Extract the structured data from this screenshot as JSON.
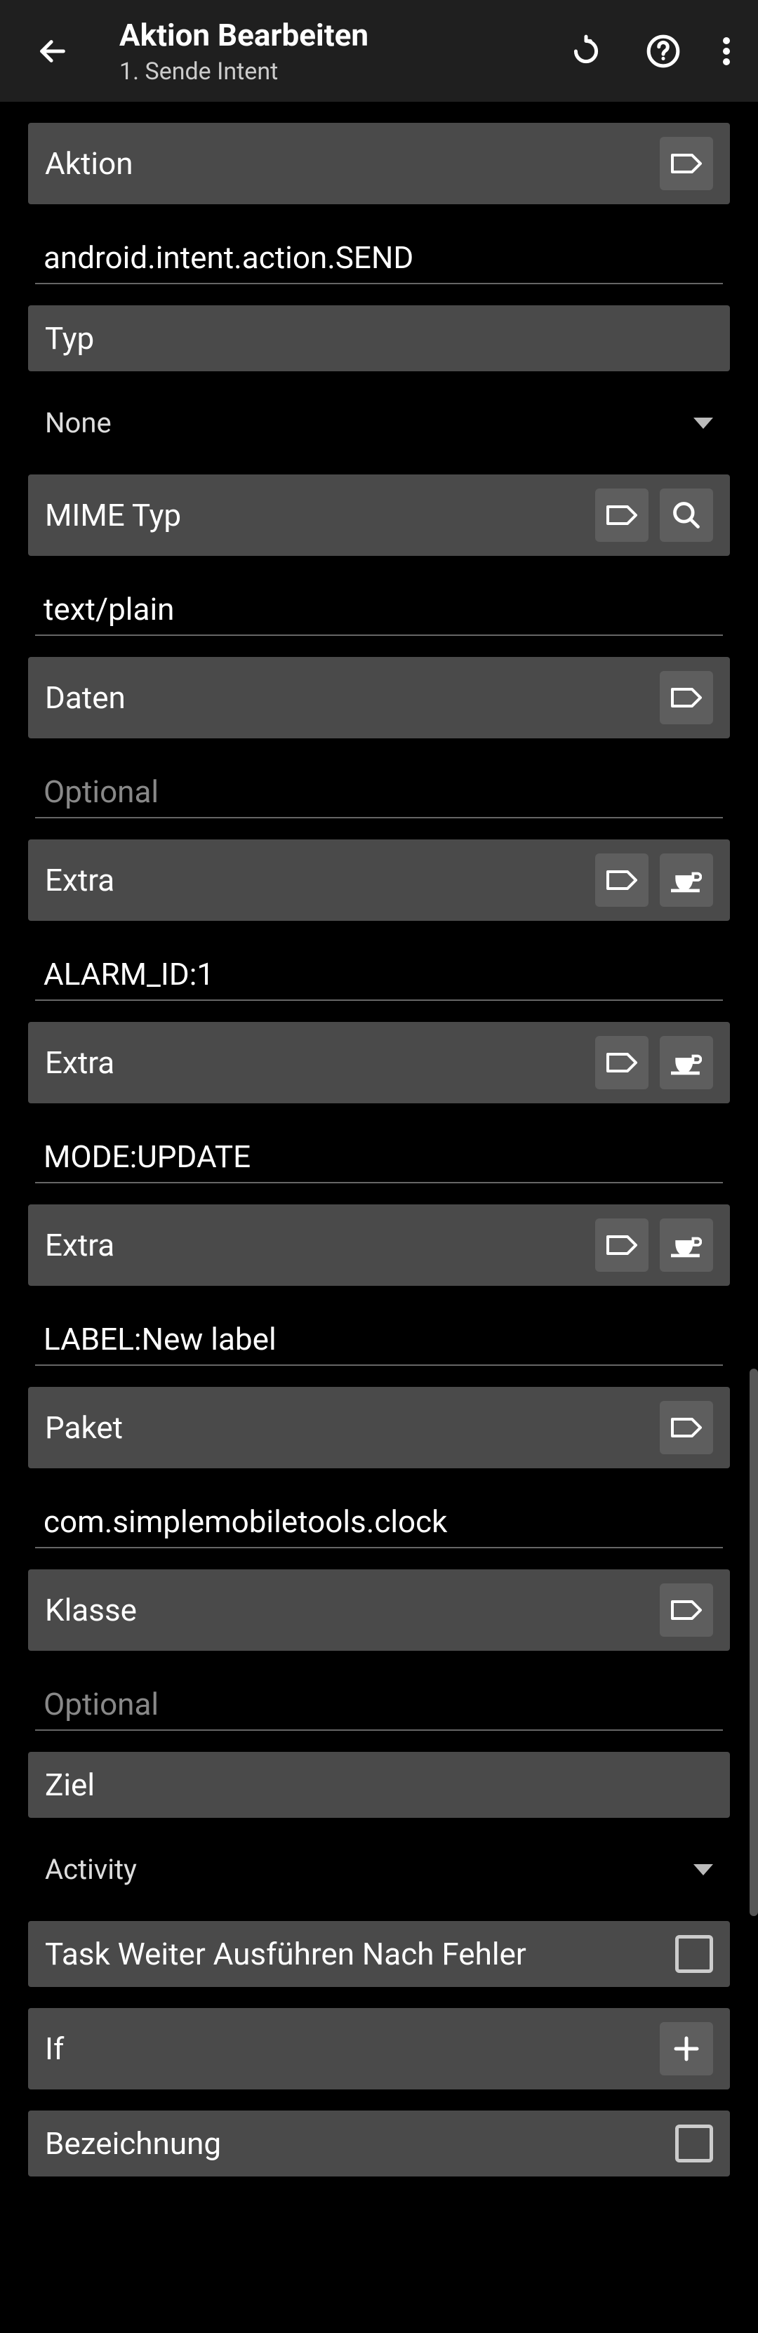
{
  "header": {
    "title": "Aktion Bearbeiten",
    "subtitle": "1. Sende Intent"
  },
  "sections": {
    "aktion": {
      "label": "Aktion",
      "value": "android.intent.action.SEND"
    },
    "typ": {
      "label": "Typ",
      "selected": "None"
    },
    "mime": {
      "label": "MIME Typ",
      "value": "text/plain"
    },
    "daten": {
      "label": "Daten",
      "placeholder": "Optional"
    },
    "extra1": {
      "label": "Extra",
      "value": "ALARM_ID:1"
    },
    "extra2": {
      "label": "Extra",
      "value": "MODE:UPDATE"
    },
    "extra3": {
      "label": "Extra",
      "value": "LABEL:New label"
    },
    "paket": {
      "label": "Paket",
      "value": "com.simplemobiletools.clock"
    },
    "klasse": {
      "label": "Klasse",
      "placeholder": "Optional"
    },
    "ziel": {
      "label": "Ziel",
      "selected": "Activity"
    },
    "continue": {
      "label": "Task Weiter Ausführen Nach Fehler"
    },
    "if": {
      "label": "If"
    },
    "bezeichnung": {
      "label": "Bezeichnung"
    }
  }
}
